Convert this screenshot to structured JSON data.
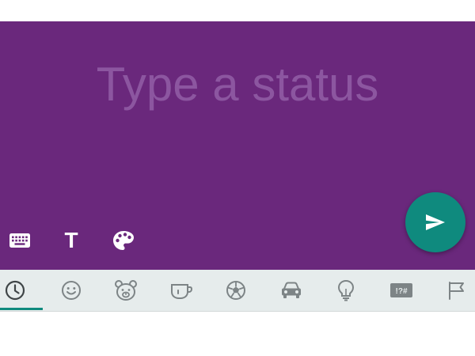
{
  "status": {
    "placeholder": "Type a status",
    "background_color": "#6a287c"
  },
  "toolbar": {
    "keyboard_icon": "keyboard-icon",
    "text_style_glyph": "T",
    "color_icon": "palette-icon"
  },
  "send": {
    "icon": "send-icon",
    "color": "#0f8a7e"
  },
  "emoji_categories": {
    "selected": "recent",
    "tabs": [
      "recent",
      "smileys",
      "animals",
      "food",
      "activities",
      "travel",
      "objects",
      "symbols",
      "flags"
    ],
    "symbols_label": "!?#"
  },
  "colors": {
    "accent": "#0f8a7e",
    "emoji_bar_bg": "#e6ecec",
    "icon_gray": "#7d8486"
  }
}
